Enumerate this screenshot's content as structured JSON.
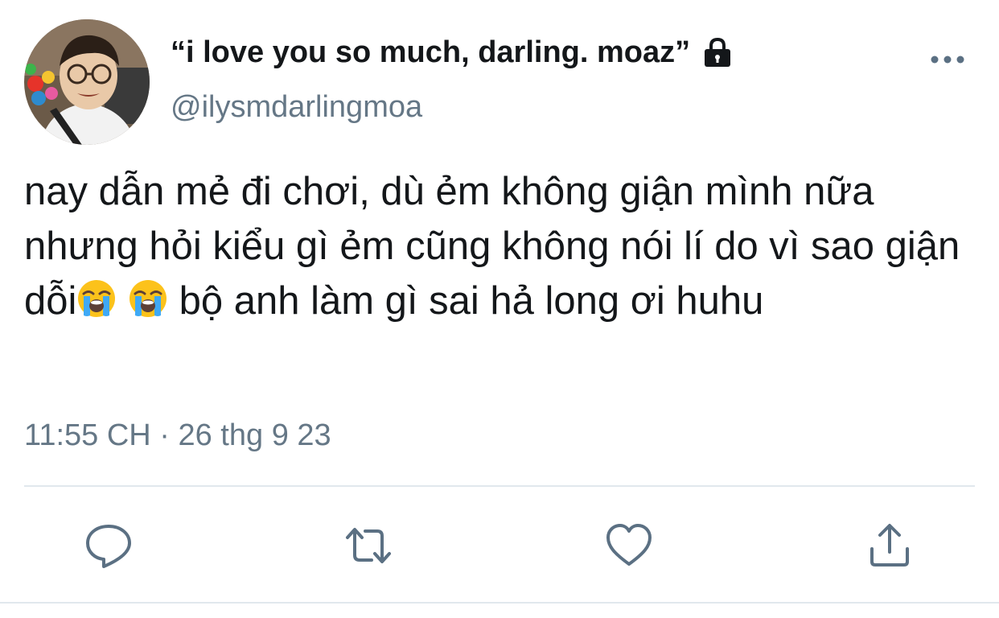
{
  "tweet": {
    "display_name": "“i love you so much, darling. moaz”",
    "handle": "@ilysmdarlingmoa",
    "text_parts": {
      "part1": "nay dẫn mẻ đi chơi, dù ẻm không giận mình nữa nhưng hỏi kiểu gì ẻm cũng không nói lí do vì sao giận dỗi",
      "part2": "  bộ anh làm gì sai hả long ơi huhu"
    },
    "emoji": [
      "loudly-crying-face",
      "loudly-crying-face"
    ],
    "timestamp": "11:55 CH · 26 thg 9 23"
  },
  "icons": {
    "lock": "lock-icon",
    "more": "more-dots-icon",
    "reply": "reply-icon",
    "retweet": "retweet-icon",
    "like": "heart-icon",
    "share": "share-icon"
  },
  "colors": {
    "text": "#14171a",
    "secondary": "#657786",
    "icon": "#5b7083",
    "divider": "#e1e8ed",
    "background": "#ffffff"
  }
}
